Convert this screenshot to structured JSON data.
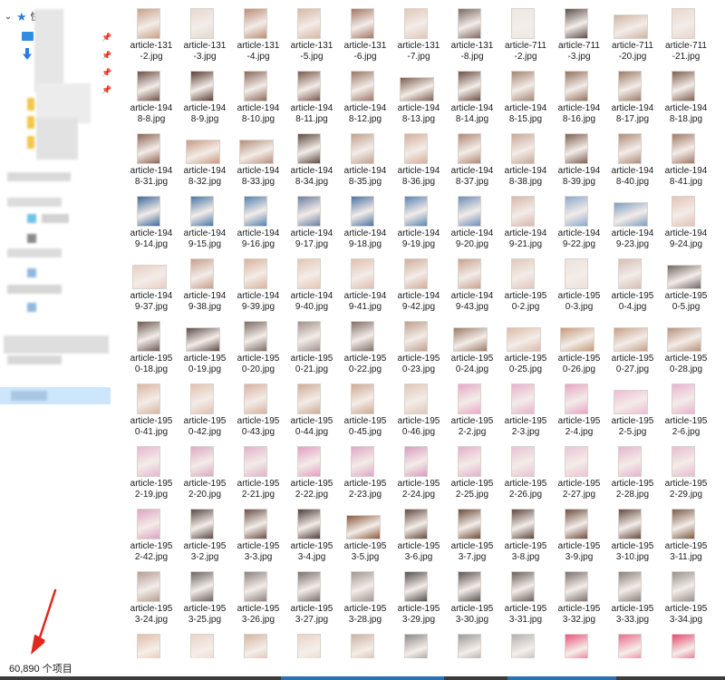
{
  "quick_access": {
    "label": "快"
  },
  "status": {
    "item_count": "60,890 个项目"
  },
  "colors": {
    "selection": "#cde6fb",
    "arrow": "#e0281e",
    "accent": "#2b7de0"
  },
  "files": [
    {
      "name": "article-1312.jpg",
      "lines": [
        "article-131",
        "-2.jpg"
      ],
      "tone": "#c9a189",
      "orient": "portrait"
    },
    {
      "name": "article-1313.jpg",
      "lines": [
        "article-131",
        "-3.jpg"
      ],
      "tone": "#e6d9cf",
      "orient": "portrait"
    },
    {
      "name": "article-1314.jpg",
      "lines": [
        "article-131",
        "-4.jpg"
      ],
      "tone": "#bb8d77",
      "orient": "portrait"
    },
    {
      "name": "article-1315.jpg",
      "lines": [
        "article-131",
        "-5.jpg"
      ],
      "tone": "#d8b7a4",
      "orient": "portrait"
    },
    {
      "name": "article-1316.jpg",
      "lines": [
        "article-131",
        "-6.jpg"
      ],
      "tone": "#a37766",
      "orient": "portrait"
    },
    {
      "name": "article-1317.jpg",
      "lines": [
        "article-131",
        "-7.jpg"
      ],
      "tone": "#e2c7b8",
      "orient": "portrait"
    },
    {
      "name": "article-1318.jpg",
      "lines": [
        "article-131",
        "-8.jpg"
      ],
      "tone": "#7d6a63",
      "orient": "portrait"
    },
    {
      "name": "article-7112.jpg",
      "lines": [
        "article-711",
        "-2.jpg"
      ],
      "tone": "#efe8e4",
      "orient": "portrait"
    },
    {
      "name": "article-7113.jpg",
      "lines": [
        "article-711",
        "-3.jpg"
      ],
      "tone": "#5b4f4c",
      "orient": "portrait"
    },
    {
      "name": "article-71120.jpg",
      "lines": [
        "article-711",
        "-20.jpg"
      ],
      "tone": "#cfb5a4",
      "orient": "landscape"
    },
    {
      "name": "article-71121.jpg",
      "lines": [
        "article-711",
        "-21.jpg"
      ],
      "tone": "#e9d7cc",
      "orient": "portrait"
    },
    {
      "name": "article-19488.jpg",
      "lines": [
        "article-194",
        "8-8.jpg"
      ],
      "tone": "#6e5147",
      "orient": "portrait"
    },
    {
      "name": "article-19489.jpg",
      "lines": [
        "article-194",
        "8-9.jpg"
      ],
      "tone": "#5a4036",
      "orient": "portrait"
    },
    {
      "name": "article-194810.jpg",
      "lines": [
        "article-194",
        "8-10.jpg"
      ],
      "tone": "#8a6a5a",
      "orient": "portrait"
    },
    {
      "name": "article-194811.jpg",
      "lines": [
        "article-194",
        "8-11.jpg"
      ],
      "tone": "#7a5a4c",
      "orient": "portrait"
    },
    {
      "name": "article-194812.jpg",
      "lines": [
        "article-194",
        "8-12.jpg"
      ],
      "tone": "#9a7866",
      "orient": "portrait"
    },
    {
      "name": "article-194813.jpg",
      "lines": [
        "article-194",
        "8-13.jpg"
      ],
      "tone": "#7e5e50",
      "orient": "landscape"
    },
    {
      "name": "article-194814.jpg",
      "lines": [
        "article-194",
        "8-14.jpg"
      ],
      "tone": "#6c5044",
      "orient": "portrait"
    },
    {
      "name": "article-194815.jpg",
      "lines": [
        "article-194",
        "8-15.jpg"
      ],
      "tone": "#a48674",
      "orient": "portrait"
    },
    {
      "name": "article-194816.jpg",
      "lines": [
        "article-194",
        "8-16.jpg"
      ],
      "tone": "#93735f",
      "orient": "portrait"
    },
    {
      "name": "article-194817.jpg",
      "lines": [
        "article-194",
        "8-17.jpg"
      ],
      "tone": "#9c7c68",
      "orient": "portrait"
    },
    {
      "name": "article-194818.jpg",
      "lines": [
        "article-194",
        "8-18.jpg"
      ],
      "tone": "#80614f",
      "orient": "portrait"
    },
    {
      "name": "article-194831.jpg",
      "lines": [
        "article-194",
        "8-31.jpg"
      ],
      "tone": "#8d6453",
      "orient": "portrait"
    },
    {
      "name": "article-194832.jpg",
      "lines": [
        "article-194",
        "8-32.jpg"
      ],
      "tone": "#c99a82",
      "orient": "landscape"
    },
    {
      "name": "article-194833.jpg",
      "lines": [
        "article-194",
        "8-33.jpg"
      ],
      "tone": "#b58e7a",
      "orient": "landscape"
    },
    {
      "name": "article-194834.jpg",
      "lines": [
        "article-194",
        "8-34.jpg"
      ],
      "tone": "#5e4a42",
      "orient": "portrait"
    },
    {
      "name": "article-194835.jpg",
      "lines": [
        "article-194",
        "8-35.jpg"
      ],
      "tone": "#c2a190",
      "orient": "portrait"
    },
    {
      "name": "article-194836.jpg",
      "lines": [
        "article-194",
        "8-36.jpg"
      ],
      "tone": "#d4b09c",
      "orient": "portrait"
    },
    {
      "name": "article-194837.jpg",
      "lines": [
        "article-194",
        "8-37.jpg"
      ],
      "tone": "#b38874",
      "orient": "portrait"
    },
    {
      "name": "article-194838.jpg",
      "lines": [
        "article-194",
        "8-38.jpg"
      ],
      "tone": "#c8a896",
      "orient": "portrait"
    },
    {
      "name": "article-194839.jpg",
      "lines": [
        "article-194",
        "8-39.jpg"
      ],
      "tone": "#7f6153",
      "orient": "portrait"
    },
    {
      "name": "article-194840.jpg",
      "lines": [
        "article-194",
        "8-40.jpg"
      ],
      "tone": "#b08c79",
      "orient": "portrait"
    },
    {
      "name": "article-194841.jpg",
      "lines": [
        "article-194",
        "8-41.jpg"
      ],
      "tone": "#a17a66",
      "orient": "portrait"
    },
    {
      "name": "article-194914.jpg",
      "lines": [
        "article-194",
        "9-14.jpg"
      ],
      "tone": "#3f6a9c",
      "orient": "portrait"
    },
    {
      "name": "article-194915.jpg",
      "lines": [
        "article-194",
        "9-15.jpg"
      ],
      "tone": "#4a78a8",
      "orient": "portrait"
    },
    {
      "name": "article-194916.jpg",
      "lines": [
        "article-194",
        "9-16.jpg"
      ],
      "tone": "#5482b0",
      "orient": "portrait"
    },
    {
      "name": "article-194917.jpg",
      "lines": [
        "article-194",
        "9-17.jpg"
      ],
      "tone": "#6b7ea0",
      "orient": "portrait"
    },
    {
      "name": "article-194918.jpg",
      "lines": [
        "article-194",
        "9-18.jpg"
      ],
      "tone": "#4d73a3",
      "orient": "portrait"
    },
    {
      "name": "article-194919.jpg",
      "lines": [
        "article-194",
        "9-19.jpg"
      ],
      "tone": "#5a86b5",
      "orient": "portrait"
    },
    {
      "name": "article-194920.jpg",
      "lines": [
        "article-194",
        "9-20.jpg"
      ],
      "tone": "#6d8fb8",
      "orient": "portrait"
    },
    {
      "name": "article-194921.jpg",
      "lines": [
        "article-194",
        "9-21.jpg"
      ],
      "tone": "#d7b8ad",
      "orient": "portrait"
    },
    {
      "name": "article-194922.jpg",
      "lines": [
        "article-194",
        "9-22.jpg"
      ],
      "tone": "#8aa9cc",
      "orient": "portrait"
    },
    {
      "name": "article-194923.jpg",
      "lines": [
        "article-194",
        "9-23.jpg"
      ],
      "tone": "#7d9ec4",
      "orient": "landscape"
    },
    {
      "name": "article-194924.jpg",
      "lines": [
        "article-194",
        "9-24.jpg"
      ],
      "tone": "#e3c3b7",
      "orient": "portrait"
    },
    {
      "name": "article-194937.jpg",
      "lines": [
        "article-194",
        "9-37.jpg"
      ],
      "tone": "#e8cfc2",
      "orient": "landscape"
    },
    {
      "name": "article-194938.jpg",
      "lines": [
        "article-194",
        "9-38.jpg"
      ],
      "tone": "#c8a08c",
      "orient": "portrait"
    },
    {
      "name": "article-194939.jpg",
      "lines": [
        "article-194",
        "9-39.jpg"
      ],
      "tone": "#d9b29c",
      "orient": "portrait"
    },
    {
      "name": "article-194940.jpg",
      "lines": [
        "article-194",
        "9-40.jpg"
      ],
      "tone": "#e4c6b5",
      "orient": "portrait"
    },
    {
      "name": "article-194941.jpg",
      "lines": [
        "article-194",
        "9-41.jpg"
      ],
      "tone": "#dfbfae",
      "orient": "portrait"
    },
    {
      "name": "article-194942.jpg",
      "lines": [
        "article-194",
        "9-42.jpg"
      ],
      "tone": "#d2ad98",
      "orient": "portrait"
    },
    {
      "name": "article-194943.jpg",
      "lines": [
        "article-194",
        "9-43.jpg"
      ],
      "tone": "#c9a38e",
      "orient": "portrait"
    },
    {
      "name": "article-19502.jpg",
      "lines": [
        "article-195",
        "0-2.jpg"
      ],
      "tone": "#e0c8bb",
      "orient": "portrait"
    },
    {
      "name": "article-19503.jpg",
      "lines": [
        "article-195",
        "0-3.jpg"
      ],
      "tone": "#ede2dc",
      "orient": "portrait"
    },
    {
      "name": "article-19504.jpg",
      "lines": [
        "article-195",
        "0-4.jpg"
      ],
      "tone": "#d5bfb5",
      "orient": "portrait"
    },
    {
      "name": "article-19505.jpg",
      "lines": [
        "article-195",
        "0-5.jpg"
      ],
      "tone": "#6f6765",
      "orient": "landscape"
    },
    {
      "name": "article-195018.jpg",
      "lines": [
        "article-195",
        "0-18.jpg"
      ],
      "tone": "#6b5a52",
      "orient": "portrait"
    },
    {
      "name": "article-195019.jpg",
      "lines": [
        "article-195",
        "0-19.jpg"
      ],
      "tone": "#5c4d47",
      "orient": "landscape"
    },
    {
      "name": "article-195020.jpg",
      "lines": [
        "article-195",
        "0-20.jpg"
      ],
      "tone": "#7d6c64",
      "orient": "portrait"
    },
    {
      "name": "article-195021.jpg",
      "lines": [
        "article-195",
        "0-21.jpg"
      ],
      "tone": "#a2918a",
      "orient": "portrait"
    },
    {
      "name": "article-195022.jpg",
      "lines": [
        "article-195",
        "0-22.jpg"
      ],
      "tone": "#827068",
      "orient": "portrait"
    },
    {
      "name": "article-195023.jpg",
      "lines": [
        "article-195",
        "0-23.jpg"
      ],
      "tone": "#c0a08e",
      "orient": "portrait"
    },
    {
      "name": "article-195024.jpg",
      "lines": [
        "article-195",
        "0-24.jpg"
      ],
      "tone": "#9c7b68",
      "orient": "landscape"
    },
    {
      "name": "article-195025.jpg",
      "lines": [
        "article-195",
        "0-25.jpg"
      ],
      "tone": "#dcbca9",
      "orient": "landscape"
    },
    {
      "name": "article-195026.jpg",
      "lines": [
        "article-195",
        "0-26.jpg"
      ],
      "tone": "#c59a7a",
      "orient": "landscape"
    },
    {
      "name": "article-195027.jpg",
      "lines": [
        "article-195",
        "0-27.jpg"
      ],
      "tone": "#c79f86",
      "orient": "landscape"
    },
    {
      "name": "article-195028.jpg",
      "lines": [
        "article-195",
        "0-28.jpg"
      ],
      "tone": "#b8907a",
      "orient": "landscape"
    },
    {
      "name": "article-195041.jpg",
      "lines": [
        "article-195",
        "0-41.jpg"
      ],
      "tone": "#dbb6a2",
      "orient": "portrait"
    },
    {
      "name": "article-195042.jpg",
      "lines": [
        "article-195",
        "0-42.jpg"
      ],
      "tone": "#e2c1b0",
      "orient": "portrait"
    },
    {
      "name": "article-195043.jpg",
      "lines": [
        "article-195",
        "0-43.jpg"
      ],
      "tone": "#d7b29f",
      "orient": "portrait"
    },
    {
      "name": "article-195044.jpg",
      "lines": [
        "article-195",
        "0-44.jpg"
      ],
      "tone": "#d0ab96",
      "orient": "portrait"
    },
    {
      "name": "article-195045.jpg",
      "lines": [
        "article-195",
        "0-45.jpg"
      ],
      "tone": "#cfa995",
      "orient": "portrait"
    },
    {
      "name": "article-195046.jpg",
      "lines": [
        "article-195",
        "0-46.jpg"
      ],
      "tone": "#e1c7b9",
      "orient": "portrait"
    },
    {
      "name": "article-19522.jpg",
      "lines": [
        "article-195",
        "2-2.jpg"
      ],
      "tone": "#e9a9c8",
      "orient": "portrait"
    },
    {
      "name": "article-19523.jpg",
      "lines": [
        "article-195",
        "2-3.jpg"
      ],
      "tone": "#e8b2cd",
      "orient": "portrait"
    },
    {
      "name": "article-19524.jpg",
      "lines": [
        "article-195",
        "2-4.jpg"
      ],
      "tone": "#e7a5c6",
      "orient": "portrait"
    },
    {
      "name": "article-19525.jpg",
      "lines": [
        "article-195",
        "2-5.jpg"
      ],
      "tone": "#efbcd5",
      "orient": "landscape"
    },
    {
      "name": "article-19526.jpg",
      "lines": [
        "article-195",
        "2-6.jpg"
      ],
      "tone": "#eab3cf",
      "orient": "portrait"
    },
    {
      "name": "article-195219.jpg",
      "lines": [
        "article-195",
        "2-19.jpg"
      ],
      "tone": "#e6b8d0",
      "orient": "portrait"
    },
    {
      "name": "article-195220.jpg",
      "lines": [
        "article-195",
        "2-20.jpg"
      ],
      "tone": "#dcaac2",
      "orient": "portrait"
    },
    {
      "name": "article-195221.jpg",
      "lines": [
        "article-195",
        "2-21.jpg"
      ],
      "tone": "#e2b2ca",
      "orient": "portrait"
    },
    {
      "name": "article-195222.jpg",
      "lines": [
        "article-195",
        "2-22.jpg"
      ],
      "tone": "#e39ec4",
      "orient": "portrait"
    },
    {
      "name": "article-195223.jpg",
      "lines": [
        "article-195",
        "2-23.jpg"
      ],
      "tone": "#e0a6c6",
      "orient": "portrait"
    },
    {
      "name": "article-195224.jpg",
      "lines": [
        "article-195",
        "2-24.jpg"
      ],
      "tone": "#d99cbf",
      "orient": "portrait"
    },
    {
      "name": "article-195225.jpg",
      "lines": [
        "article-195",
        "2-25.jpg"
      ],
      "tone": "#e4b0cb",
      "orient": "portrait"
    },
    {
      "name": "article-195226.jpg",
      "lines": [
        "article-195",
        "2-26.jpg"
      ],
      "tone": "#e9c2d5",
      "orient": "portrait"
    },
    {
      "name": "article-195227.jpg",
      "lines": [
        "article-195",
        "2-27.jpg"
      ],
      "tone": "#ecc4d7",
      "orient": "portrait"
    },
    {
      "name": "article-195228.jpg",
      "lines": [
        "article-195",
        "2-28.jpg"
      ],
      "tone": "#e6b5cd",
      "orient": "portrait"
    },
    {
      "name": "article-195229.jpg",
      "lines": [
        "article-195",
        "2-29.jpg"
      ],
      "tone": "#e8bcd1",
      "orient": "portrait"
    },
    {
      "name": "article-195242.jpg",
      "lines": [
        "article-195",
        "2-42.jpg"
      ],
      "tone": "#dea3c2",
      "orient": "portrait"
    },
    {
      "name": "article-19532.jpg",
      "lines": [
        "article-195",
        "3-2.jpg"
      ],
      "tone": "#5a4a44",
      "orient": "portrait"
    },
    {
      "name": "article-19533.jpg",
      "lines": [
        "article-195",
        "3-3.jpg"
      ],
      "tone": "#6b5149",
      "orient": "portrait"
    },
    {
      "name": "article-19534.jpg",
      "lines": [
        "article-195",
        "3-4.jpg"
      ],
      "tone": "#4f3f3a",
      "orient": "portrait"
    },
    {
      "name": "article-19535.jpg",
      "lines": [
        "article-195",
        "3-5.jpg"
      ],
      "tone": "#8a5b40",
      "orient": "landscape"
    },
    {
      "name": "article-19536.jpg",
      "lines": [
        "article-195",
        "3-6.jpg"
      ],
      "tone": "#624b41",
      "orient": "portrait"
    },
    {
      "name": "article-19537.jpg",
      "lines": [
        "article-195",
        "3-7.jpg"
      ],
      "tone": "#6d4d3c",
      "orient": "portrait"
    },
    {
      "name": "article-19538.jpg",
      "lines": [
        "article-195",
        "3-8.jpg"
      ],
      "tone": "#5e4840",
      "orient": "portrait"
    },
    {
      "name": "article-19539.jpg",
      "lines": [
        "article-195",
        "3-9.jpg"
      ],
      "tone": "#704f40",
      "orient": "portrait"
    },
    {
      "name": "article-195310.jpg",
      "lines": [
        "article-195",
        "3-10.jpg"
      ],
      "tone": "#654c42",
      "orient": "portrait"
    },
    {
      "name": "article-195311.jpg",
      "lines": [
        "article-195",
        "3-11.jpg"
      ],
      "tone": "#7c5c48",
      "orient": "portrait"
    },
    {
      "name": "article-195324.jpg",
      "lines": [
        "article-195",
        "3-24.jpg"
      ],
      "tone": "#b59e93",
      "orient": "portrait"
    },
    {
      "name": "article-195325.jpg",
      "lines": [
        "article-195",
        "3-25.jpg"
      ],
      "tone": "#6d6360",
      "orient": "portrait"
    },
    {
      "name": "article-195326.jpg",
      "lines": [
        "article-195",
        "3-26.jpg"
      ],
      "tone": "#8c8380",
      "orient": "portrait"
    },
    {
      "name": "article-195327.jpg",
      "lines": [
        "article-195",
        "3-27.jpg"
      ],
      "tone": "#7a716e",
      "orient": "portrait"
    },
    {
      "name": "article-195328.jpg",
      "lines": [
        "article-195",
        "3-28.jpg"
      ],
      "tone": "#a19692",
      "orient": "portrait"
    },
    {
      "name": "article-195329.jpg",
      "lines": [
        "article-195",
        "3-29.jpg"
      ],
      "tone": "#555050",
      "orient": "portrait"
    },
    {
      "name": "article-195330.jpg",
      "lines": [
        "article-195",
        "3-30.jpg"
      ],
      "tone": "#5b5553",
      "orient": "portrait"
    },
    {
      "name": "article-195331.jpg",
      "lines": [
        "article-195",
        "3-31.jpg"
      ],
      "tone": "#6a5f5b",
      "orient": "portrait"
    },
    {
      "name": "article-195332.jpg",
      "lines": [
        "article-195",
        "3-32.jpg"
      ],
      "tone": "#7c7270",
      "orient": "portrait"
    },
    {
      "name": "article-195333.jpg",
      "lines": [
        "article-195",
        "3-33.jpg"
      ],
      "tone": "#8b817c",
      "orient": "portrait"
    },
    {
      "name": "article-195334.jpg",
      "lines": [
        "article-195",
        "3-34.jpg"
      ],
      "tone": "#9a908b",
      "orient": "portrait"
    }
  ],
  "partial_row": [
    {
      "tone": "#e2bea9",
      "orient": "portrait"
    },
    {
      "tone": "#ead4c6",
      "orient": "portrait"
    },
    {
      "tone": "#d4b6a3",
      "orient": "portrait"
    },
    {
      "tone": "#e7d3c6",
      "orient": "portrait"
    },
    {
      "tone": "#cbb1a3",
      "orient": "portrait"
    },
    {
      "tone": "#8a8a8a",
      "orient": "portrait"
    },
    {
      "tone": "#9a9a9a",
      "orient": "portrait"
    },
    {
      "tone": "#b1b1b1",
      "orient": "portrait"
    },
    {
      "tone": "#e7557f",
      "orient": "portrait"
    },
    {
      "tone": "#ea6a8e",
      "orient": "portrait"
    },
    {
      "tone": "#e4496f",
      "orient": "portrait"
    }
  ]
}
